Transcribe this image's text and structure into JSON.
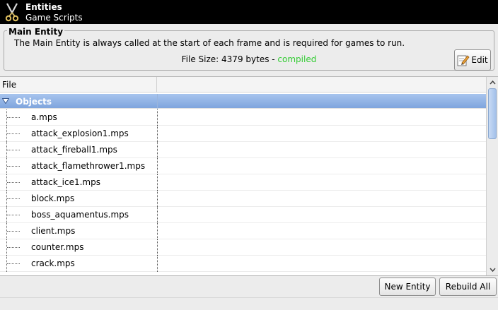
{
  "titlebar": {
    "title": "Entities",
    "subtitle": "Game Scripts",
    "icon": "scissors-icon"
  },
  "main_entity": {
    "legend": "Main Entity",
    "description": "The Main Entity is always called at the start of each frame and is required for games to run.",
    "file_size_label": "File Size: 4379 bytes - ",
    "status": "compiled",
    "status_color": "#33cc33",
    "edit_label": "Edit"
  },
  "tree": {
    "columns": [
      "File",
      ""
    ],
    "group": {
      "label": "Objects",
      "expanded": true,
      "color": "#8fb2e4"
    },
    "files": [
      "a.mps",
      "attack_explosion1.mps",
      "attack_fireball1.mps",
      "attack_flamethrower1.mps",
      "attack_ice1.mps",
      "block.mps",
      "boss_aquamentus.mps",
      "client.mps",
      "counter.mps",
      "crack.mps"
    ]
  },
  "buttons": {
    "new_entity": "New Entity",
    "rebuild_all": "Rebuild All"
  }
}
